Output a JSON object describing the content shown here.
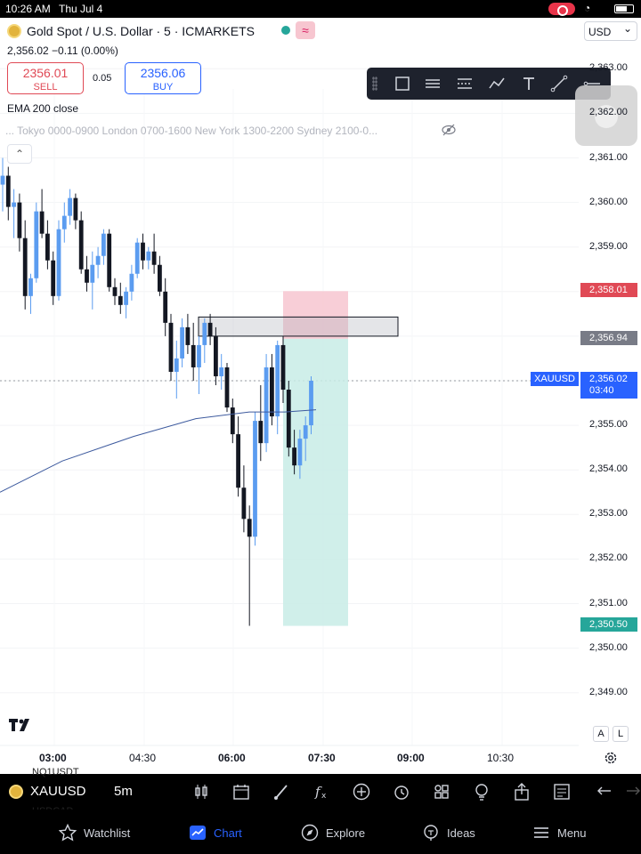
{
  "status_bar": {
    "time": "10:26 AM",
    "date": "Thu Jul 4"
  },
  "header": {
    "symbol_title": "Gold Spot / U.S. Dollar · 5 · ICMARKETS",
    "currency": "USD",
    "price_line": "2,356.02 −0.11 (0.00%)",
    "sell_price": "2356.01",
    "sell_label": "SELL",
    "spread": "0.05",
    "buy_price": "2356.06",
    "buy_label": "BUY",
    "indicator": "EMA 200 close",
    "sessions": "... Tokyo 0000-0900 London 0700-1600 New York 1300-2200 Sydney 2100-0..."
  },
  "price_axis": {
    "ticks": [
      "2,363.00",
      "2,362.00",
      "2,361.00",
      "2,360.00",
      "2,359.00",
      "2,358.00",
      "2,357.00",
      "2,356.00",
      "2,355.00",
      "2,354.00",
      "2,353.00",
      "2,352.00",
      "2,351.00",
      "2,350.00",
      "2,349.00"
    ],
    "stop_tag": "2,358.01",
    "entry_tag": "2,356.94",
    "current_symbol": "XAUUSD",
    "current_price": "2,356.02",
    "countdown": "03:40",
    "target_tag": "2,350.50"
  },
  "time_axis": {
    "labels": [
      "03:00",
      "04:30",
      "06:00",
      "07:30",
      "09:00",
      "10:30"
    ]
  },
  "chart_controls": {
    "auto_label": "A",
    "log_label": "L"
  },
  "colors": {
    "accent": "#2962ff",
    "up": "#5b9cf0",
    "down": "#131722",
    "stop": "#f7c6d0",
    "target": "#c8ece6",
    "ema": "#3d5a9e"
  },
  "bottom_toolbar": {
    "symbol": "XAUUSD",
    "timeframe": "5m",
    "ghost_items": [
      "NQ1USDT",
      "USDCAD"
    ]
  },
  "bottom_nav": [
    {
      "label": "Watchlist",
      "icon": "star-icon"
    },
    {
      "label": "Chart",
      "icon": "chart-icon"
    },
    {
      "label": "Explore",
      "icon": "compass-icon"
    },
    {
      "label": "Ideas",
      "icon": "bulb-icon"
    },
    {
      "label": "Menu",
      "icon": "menu-icon"
    }
  ],
  "chart_data": {
    "type": "candlestick",
    "title": "Gold Spot / U.S. Dollar · 5 · ICMARKETS",
    "ylim": [
      2348.5,
      2363.3
    ],
    "x_ticks": [
      "03:00",
      "04:30",
      "06:00",
      "07:30",
      "09:00",
      "10:30"
    ],
    "candles": [
      [
        2360.4,
        2361.0,
        2359.8,
        2360.6
      ],
      [
        2360.6,
        2360.8,
        2359.6,
        2359.9
      ],
      [
        2359.9,
        2360.3,
        2359.2,
        2360.0
      ],
      [
        2360.0,
        2360.2,
        2358.9,
        2359.2
      ],
      [
        2359.2,
        2359.6,
        2357.6,
        2357.9
      ],
      [
        2357.9,
        2358.4,
        2357.5,
        2358.3
      ],
      [
        2358.3,
        2360.0,
        2358.2,
        2359.8
      ],
      [
        2359.8,
        2360.3,
        2359.2,
        2359.3
      ],
      [
        2359.3,
        2359.6,
        2358.5,
        2358.7
      ],
      [
        2358.7,
        2358.9,
        2357.7,
        2357.9
      ],
      [
        2357.9,
        2359.6,
        2357.8,
        2359.4
      ],
      [
        2359.4,
        2360.0,
        2359.1,
        2359.7
      ],
      [
        2359.7,
        2360.3,
        2359.5,
        2360.1
      ],
      [
        2360.1,
        2360.2,
        2359.4,
        2359.6
      ],
      [
        2359.6,
        2359.8,
        2358.4,
        2358.5
      ],
      [
        2358.5,
        2358.8,
        2358.0,
        2358.2
      ],
      [
        2358.2,
        2358.9,
        2357.6,
        2358.6
      ],
      [
        2358.6,
        2359.0,
        2358.3,
        2358.8
      ],
      [
        2358.8,
        2359.4,
        2358.6,
        2359.3
      ],
      [
        2359.3,
        2359.4,
        2358.0,
        2358.1
      ],
      [
        2358.1,
        2358.3,
        2357.7,
        2357.9
      ],
      [
        2357.9,
        2358.2,
        2357.5,
        2357.7
      ],
      [
        2357.7,
        2358.1,
        2357.4,
        2358.0
      ],
      [
        2358.0,
        2358.6,
        2357.8,
        2358.4
      ],
      [
        2358.4,
        2359.2,
        2358.3,
        2359.1
      ],
      [
        2359.1,
        2359.3,
        2358.5,
        2358.7
      ],
      [
        2358.7,
        2359.0,
        2358.5,
        2358.9
      ],
      [
        2358.9,
        2359.3,
        2358.4,
        2358.6
      ],
      [
        2358.6,
        2358.8,
        2357.9,
        2358.0
      ],
      [
        2358.0,
        2358.3,
        2357.0,
        2357.3
      ],
      [
        2357.3,
        2357.5,
        2356.0,
        2356.2
      ],
      [
        2356.2,
        2356.9,
        2355.6,
        2356.5
      ],
      [
        2356.5,
        2357.4,
        2356.3,
        2357.2
      ],
      [
        2357.2,
        2357.5,
        2356.6,
        2356.8
      ],
      [
        2356.8,
        2357.3,
        2356.0,
        2356.3
      ],
      [
        2356.3,
        2357.0,
        2355.7,
        2356.8
      ],
      [
        2356.8,
        2357.4,
        2356.4,
        2357.3
      ],
      [
        2357.3,
        2357.5,
        2356.8,
        2357.0
      ],
      [
        2357.0,
        2357.2,
        2355.9,
        2356.1
      ],
      [
        2356.1,
        2356.6,
        2355.8,
        2356.3
      ],
      [
        2356.3,
        2356.4,
        2355.3,
        2355.4
      ],
      [
        2355.4,
        2355.6,
        2354.6,
        2354.8
      ],
      [
        2354.8,
        2355.2,
        2353.4,
        2353.6
      ],
      [
        2353.6,
        2354.1,
        2352.6,
        2352.9
      ],
      [
        2352.9,
        2353.2,
        2350.5,
        2352.5
      ],
      [
        2352.5,
        2355.3,
        2352.3,
        2355.1
      ],
      [
        2355.1,
        2355.9,
        2354.2,
        2354.6
      ],
      [
        2354.6,
        2356.6,
        2354.4,
        2356.3
      ],
      [
        2356.3,
        2356.6,
        2355.0,
        2355.2
      ],
      [
        2355.2,
        2356.9,
        2354.8,
        2356.8
      ],
      [
        2356.8,
        2357.0,
        2355.5,
        2355.8
      ],
      [
        2355.8,
        2356.0,
        2354.3,
        2354.5
      ],
      [
        2354.5,
        2354.9,
        2353.9,
        2354.1
      ],
      [
        2354.1,
        2354.9,
        2353.8,
        2354.7
      ],
      [
        2354.7,
        2355.2,
        2354.2,
        2355.0
      ],
      [
        2355.0,
        2356.1,
        2354.8,
        2356.0
      ]
    ],
    "ema200": [
      [
        0,
        2353.5
      ],
      [
        70,
        2354.2
      ],
      [
        150,
        2354.75
      ],
      [
        220,
        2355.15
      ],
      [
        280,
        2355.3
      ],
      [
        320,
        2355.3
      ],
      [
        355,
        2355.35
      ]
    ],
    "zones": {
      "supply": [
        2357.0,
        2357.43
      ],
      "stop": [
        2356.94,
        2358.01
      ],
      "target": [
        2350.5,
        2356.94
      ]
    }
  }
}
